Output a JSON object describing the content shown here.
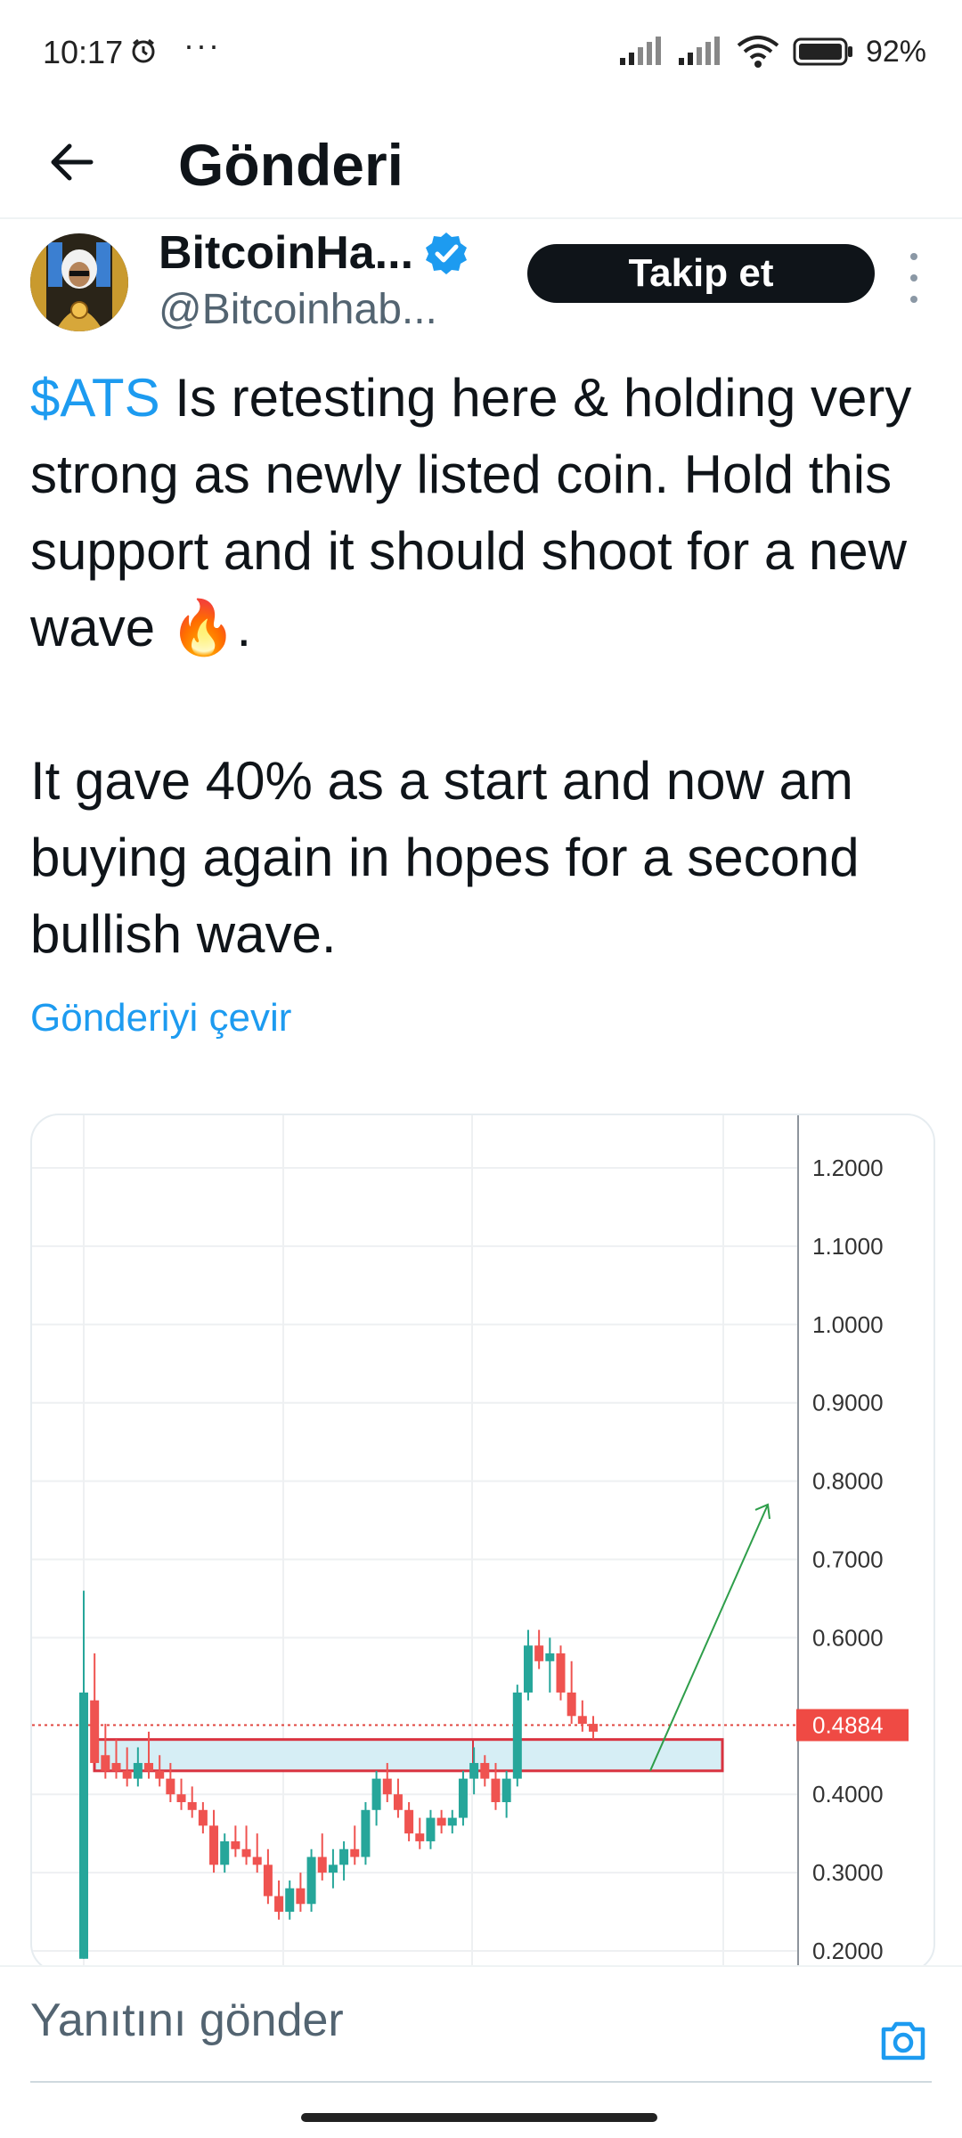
{
  "status_bar": {
    "time": "10:17",
    "dots": "···",
    "battery": "92%",
    "icons": [
      "alarm-icon",
      "signal-icon",
      "signal-icon",
      "wifi-icon",
      "battery-icon"
    ]
  },
  "header": {
    "title": "Gönderi",
    "back_icon": "arrow-left-icon"
  },
  "author": {
    "name": "BitcoinHa...",
    "handle": "@Bitcoinhab...",
    "verified": true,
    "follow_label": "Takip et",
    "more_icon": "more-vertical-icon"
  },
  "tweet": {
    "cashtag": "$ATS",
    "line1_rest": " Is retesting here & holding very strong as newly listed coin. Hold this support and it should shoot for a new wave 🔥.",
    "paragraph2": "It gave 40% as a start and now am buying again in hopes for a second bullish wave.",
    "translate_label": "Gönderiyi çevir"
  },
  "chart_data": {
    "type": "candlestick",
    "y_ticks": [
      "1.2000",
      "1.1000",
      "1.0000",
      "0.9000",
      "0.8000",
      "0.7000",
      "0.6000",
      "0.4000",
      "0.3000",
      "0.2000"
    ],
    "last_price_label": "0.4884",
    "last_price": 0.4884,
    "ylim": [
      0.2,
      1.2
    ],
    "support_zone": [
      0.43,
      0.47
    ],
    "arrow_target": 0.77,
    "candles": [
      {
        "o": 0.19,
        "h": 0.66,
        "l": 0.19,
        "c": 0.53,
        "d": "up"
      },
      {
        "o": 0.52,
        "h": 0.58,
        "l": 0.44,
        "c": 0.44,
        "d": "down"
      },
      {
        "o": 0.45,
        "h": 0.49,
        "l": 0.42,
        "c": 0.43,
        "d": "down"
      },
      {
        "o": 0.44,
        "h": 0.47,
        "l": 0.42,
        "c": 0.43,
        "d": "down"
      },
      {
        "o": 0.43,
        "h": 0.46,
        "l": 0.41,
        "c": 0.42,
        "d": "down"
      },
      {
        "o": 0.42,
        "h": 0.46,
        "l": 0.41,
        "c": 0.44,
        "d": "up"
      },
      {
        "o": 0.44,
        "h": 0.48,
        "l": 0.42,
        "c": 0.43,
        "d": "down"
      },
      {
        "o": 0.43,
        "h": 0.45,
        "l": 0.41,
        "c": 0.42,
        "d": "down"
      },
      {
        "o": 0.42,
        "h": 0.44,
        "l": 0.39,
        "c": 0.4,
        "d": "down"
      },
      {
        "o": 0.4,
        "h": 0.42,
        "l": 0.38,
        "c": 0.39,
        "d": "down"
      },
      {
        "o": 0.39,
        "h": 0.41,
        "l": 0.37,
        "c": 0.38,
        "d": "down"
      },
      {
        "o": 0.38,
        "h": 0.39,
        "l": 0.35,
        "c": 0.36,
        "d": "down"
      },
      {
        "o": 0.36,
        "h": 0.38,
        "l": 0.3,
        "c": 0.31,
        "d": "down"
      },
      {
        "o": 0.31,
        "h": 0.35,
        "l": 0.3,
        "c": 0.34,
        "d": "up"
      },
      {
        "o": 0.34,
        "h": 0.36,
        "l": 0.32,
        "c": 0.33,
        "d": "down"
      },
      {
        "o": 0.33,
        "h": 0.36,
        "l": 0.31,
        "c": 0.32,
        "d": "down"
      },
      {
        "o": 0.32,
        "h": 0.35,
        "l": 0.3,
        "c": 0.31,
        "d": "down"
      },
      {
        "o": 0.31,
        "h": 0.33,
        "l": 0.26,
        "c": 0.27,
        "d": "down"
      },
      {
        "o": 0.27,
        "h": 0.29,
        "l": 0.24,
        "c": 0.25,
        "d": "down"
      },
      {
        "o": 0.25,
        "h": 0.29,
        "l": 0.24,
        "c": 0.28,
        "d": "up"
      },
      {
        "o": 0.28,
        "h": 0.3,
        "l": 0.25,
        "c": 0.26,
        "d": "down"
      },
      {
        "o": 0.26,
        "h": 0.33,
        "l": 0.25,
        "c": 0.32,
        "d": "up"
      },
      {
        "o": 0.32,
        "h": 0.35,
        "l": 0.29,
        "c": 0.3,
        "d": "down"
      },
      {
        "o": 0.3,
        "h": 0.33,
        "l": 0.28,
        "c": 0.31,
        "d": "up"
      },
      {
        "o": 0.31,
        "h": 0.34,
        "l": 0.29,
        "c": 0.33,
        "d": "up"
      },
      {
        "o": 0.33,
        "h": 0.36,
        "l": 0.31,
        "c": 0.32,
        "d": "down"
      },
      {
        "o": 0.32,
        "h": 0.39,
        "l": 0.31,
        "c": 0.38,
        "d": "up"
      },
      {
        "o": 0.38,
        "h": 0.43,
        "l": 0.36,
        "c": 0.42,
        "d": "up"
      },
      {
        "o": 0.42,
        "h": 0.44,
        "l": 0.39,
        "c": 0.4,
        "d": "down"
      },
      {
        "o": 0.4,
        "h": 0.42,
        "l": 0.37,
        "c": 0.38,
        "d": "down"
      },
      {
        "o": 0.38,
        "h": 0.39,
        "l": 0.34,
        "c": 0.35,
        "d": "down"
      },
      {
        "o": 0.35,
        "h": 0.37,
        "l": 0.33,
        "c": 0.34,
        "d": "down"
      },
      {
        "o": 0.34,
        "h": 0.38,
        "l": 0.33,
        "c": 0.37,
        "d": "up"
      },
      {
        "o": 0.37,
        "h": 0.38,
        "l": 0.35,
        "c": 0.36,
        "d": "down"
      },
      {
        "o": 0.36,
        "h": 0.38,
        "l": 0.35,
        "c": 0.37,
        "d": "up"
      },
      {
        "o": 0.37,
        "h": 0.43,
        "l": 0.36,
        "c": 0.42,
        "d": "up"
      },
      {
        "o": 0.42,
        "h": 0.46,
        "l": 0.4,
        "c": 0.44,
        "d": "up"
      },
      {
        "o": 0.44,
        "h": 0.45,
        "l": 0.41,
        "c": 0.42,
        "d": "down"
      },
      {
        "o": 0.42,
        "h": 0.44,
        "l": 0.38,
        "c": 0.39,
        "d": "down"
      },
      {
        "o": 0.39,
        "h": 0.43,
        "l": 0.37,
        "c": 0.42,
        "d": "up"
      },
      {
        "o": 0.42,
        "h": 0.54,
        "l": 0.41,
        "c": 0.53,
        "d": "up"
      },
      {
        "o": 0.53,
        "h": 0.61,
        "l": 0.52,
        "c": 0.59,
        "d": "up"
      },
      {
        "o": 0.59,
        "h": 0.61,
        "l": 0.56,
        "c": 0.57,
        "d": "down"
      },
      {
        "o": 0.57,
        "h": 0.6,
        "l": 0.53,
        "c": 0.58,
        "d": "up"
      },
      {
        "o": 0.58,
        "h": 0.59,
        "l": 0.52,
        "c": 0.53,
        "d": "down"
      },
      {
        "o": 0.53,
        "h": 0.57,
        "l": 0.49,
        "c": 0.5,
        "d": "down"
      },
      {
        "o": 0.5,
        "h": 0.52,
        "l": 0.48,
        "c": 0.49,
        "d": "down"
      },
      {
        "o": 0.49,
        "h": 0.5,
        "l": 0.47,
        "c": 0.48,
        "d": "down"
      }
    ]
  },
  "reply": {
    "placeholder": "Yanıtını gönder",
    "camera_icon": "camera-icon"
  }
}
